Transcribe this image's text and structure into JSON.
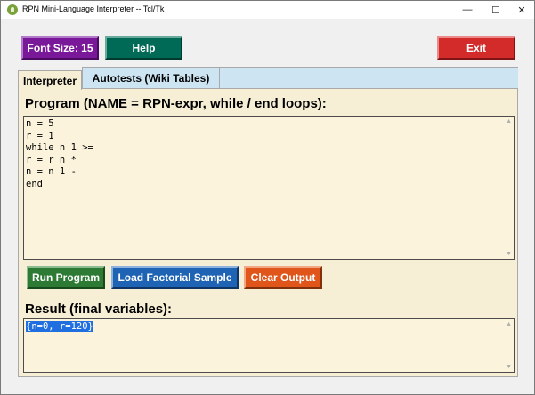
{
  "window": {
    "title": "RPN Mini-Language Interpreter -- Tcl/Tk",
    "controls": {
      "minimize": "—",
      "maximize": "☐",
      "close": "✕"
    }
  },
  "toolbar": {
    "font_size_label": "Font Size: 15",
    "help_label": "Help",
    "exit_label": "Exit"
  },
  "tabs": [
    {
      "label": "Interpreter",
      "selected": true
    },
    {
      "label": "Autotests (Wiki Tables)",
      "selected": false
    }
  ],
  "program": {
    "heading": "Program (NAME = RPN-expr, while / end loops):",
    "code": "n = 5\nr = 1\nwhile n 1 >=\nr = r n *\nn = n 1 -\nend"
  },
  "actions": {
    "run_label": "Run Program",
    "load_label": "Load Factorial Sample",
    "clear_label": "Clear Output"
  },
  "result": {
    "heading": "Result (final variables):",
    "output": "{n=0, r=120}"
  },
  "colors": {
    "font_button": "#7a189a",
    "help_button": "#006a56",
    "exit_button": "#d32a2a",
    "run_button": "#2c7a33",
    "load_button": "#1e63b4",
    "clear_button": "#e0551a",
    "panel_bg": "#f7efd5",
    "tab_inactive_bg": "#cde4f3",
    "selection": "#1f6fe0"
  },
  "icons": {
    "app": "tk-feather-icon",
    "scroll_up": "triangle-up-icon",
    "scroll_down": "triangle-down-icon"
  }
}
